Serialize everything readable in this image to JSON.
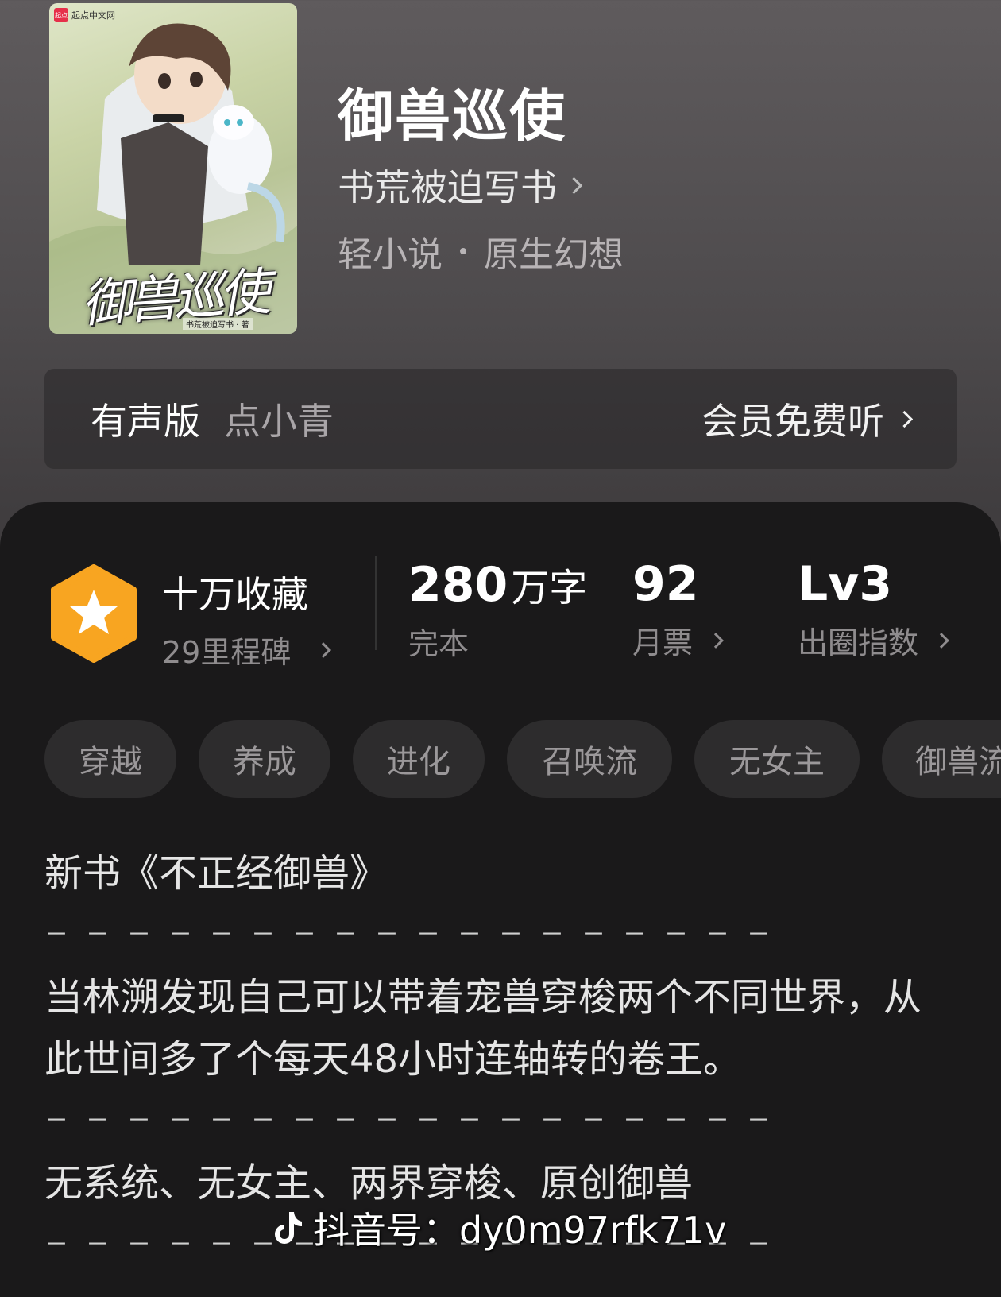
{
  "cover": {
    "publisher": "起点中文网",
    "publisher_logo": "起点",
    "art_title": "御兽巡使",
    "art_author": "书荒被迫写书 · 著"
  },
  "book": {
    "title": "御兽巡使",
    "author": "书荒被迫写书",
    "category": "轻小说",
    "subcategory": "原生幻想"
  },
  "audio": {
    "label": "有声版",
    "narrator": "点小青",
    "action": "会员免费听"
  },
  "stats": {
    "collect": {
      "value": "十万收藏",
      "sub": "29里程碑"
    },
    "words": {
      "value": "280",
      "unit": "万字",
      "label": "完本"
    },
    "tickets": {
      "value": "92",
      "label": "月票"
    },
    "index": {
      "value": "Lv3",
      "label": "出圈指数"
    }
  },
  "tags": [
    "穿越",
    "养成",
    "进化",
    "召唤流",
    "无女主",
    "御兽流"
  ],
  "description": {
    "line1": "新书《不正经御兽》",
    "divider": "－－－－－－－－－－－－－－－－－－",
    "para": "当林溯发现自己可以带着宠兽穿梭两个不同世界，从此世间多了个每天48小时连轴转的卷王。",
    "line3": "无系统、无女主、两界穿梭、原创御兽"
  },
  "watermark": "抖音号：dy0m97rfk71v",
  "colors": {
    "badge": "#f8a521",
    "panel": "#1a191a",
    "tag_bg": "#2d2c2d"
  }
}
